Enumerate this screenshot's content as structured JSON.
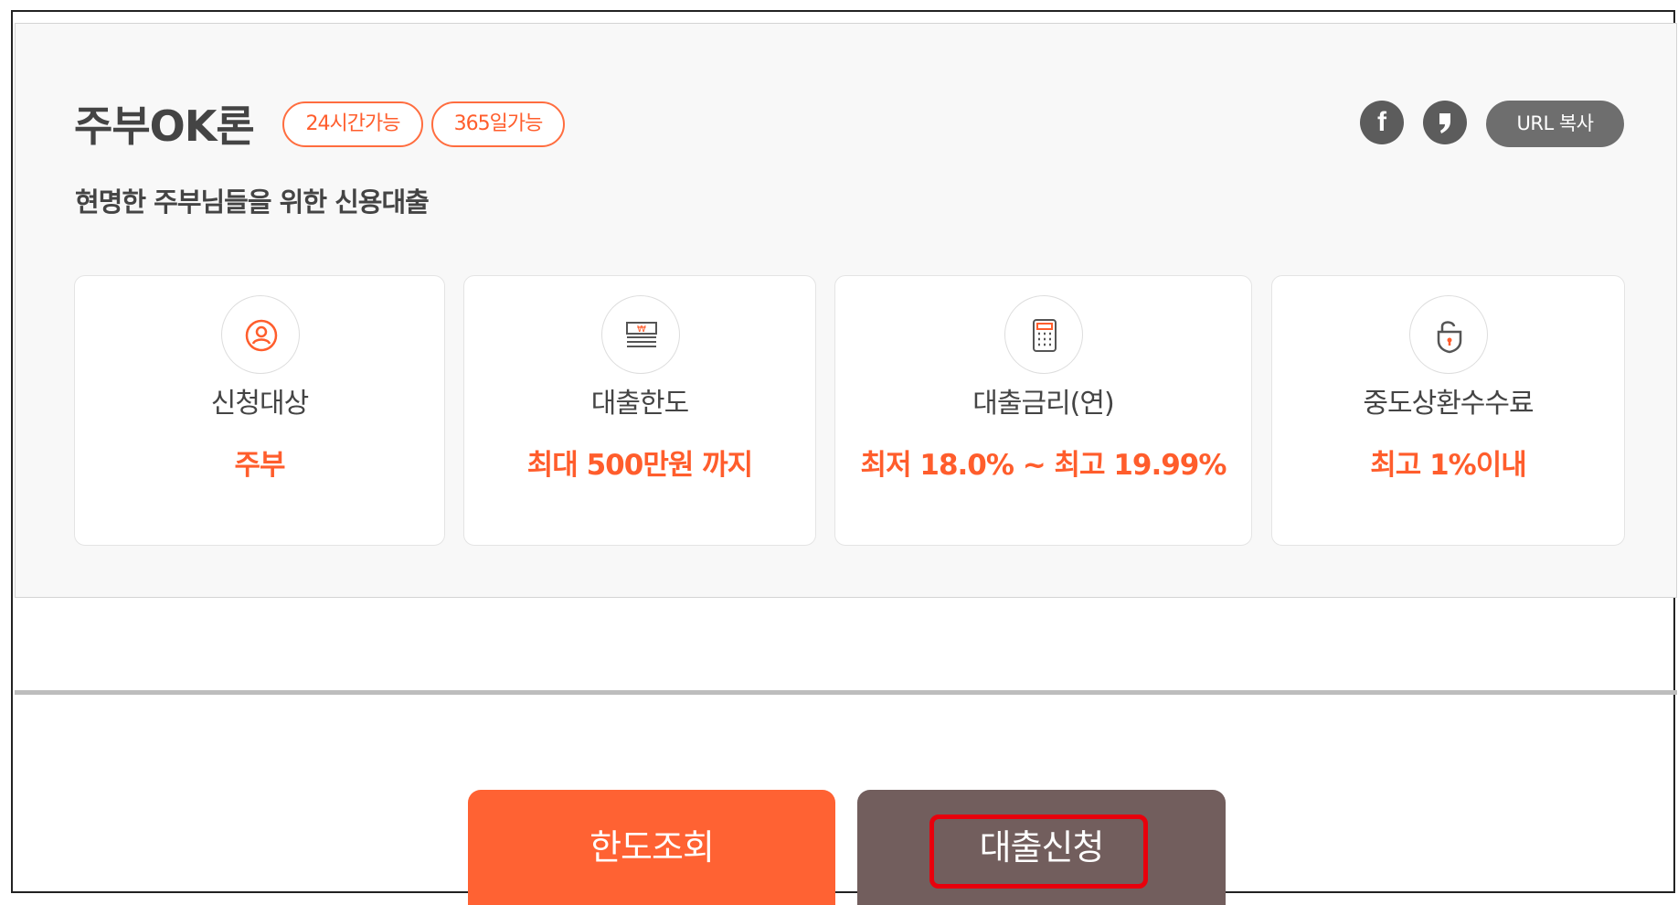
{
  "product": {
    "title": "주부OK론",
    "badges": [
      "24시간가능",
      "365일가능"
    ],
    "subtitle": "현명한 주부님들을 위한 신용대출"
  },
  "share": {
    "facebook_glyph": "f",
    "url_copy_label": "URL 복사"
  },
  "cards": [
    {
      "icon": "user-icon",
      "label": "신청대상",
      "value": "주부"
    },
    {
      "icon": "money-icon",
      "label": "대출한도",
      "value": "최대 500만원 까지"
    },
    {
      "icon": "calculator-icon",
      "label": "대출금리(연)",
      "value": "최저 18.0% ~ 최고 19.99%"
    },
    {
      "icon": "lock-icon",
      "label": "중도상환수수료",
      "value": "최고 1%이내"
    }
  ],
  "actions": {
    "limit_check": "한도조회",
    "apply": "대출신청"
  },
  "colors": {
    "accent": "#ff5d2c",
    "badge_border": "#ff6d3f",
    "limit_button": "#ff6233",
    "apply_button": "#725e5d",
    "share_icon": "#5c5c5c",
    "highlight": "#e8000c"
  }
}
